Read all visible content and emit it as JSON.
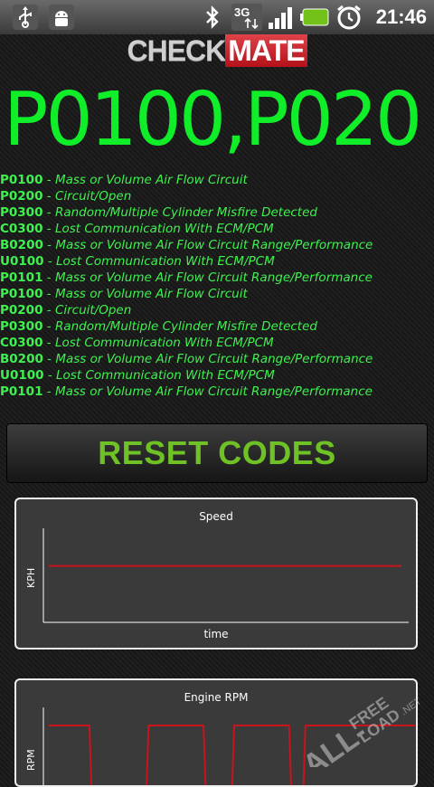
{
  "status_bar": {
    "time": "21:46",
    "network": "3G",
    "icons": [
      "usb-icon",
      "android-debug-icon",
      "bluetooth-icon",
      "network-3g-icon",
      "signal-icon",
      "battery-icon",
      "alarm-icon"
    ]
  },
  "logo": {
    "part1": "CHECK",
    "part2": "MATE"
  },
  "big_codes": "P0100,P020",
  "codes": [
    {
      "code": "P0100",
      "sep": " - ",
      "desc": "Mass or Volume Air Flow Circuit"
    },
    {
      "code": "P0200",
      "sep": " - ",
      "desc": "Circuit/Open"
    },
    {
      "code": "P0300",
      "sep": " - ",
      "desc": "Random/Multiple Cylinder Misfire Detected"
    },
    {
      "code": "C0300",
      "sep": " - ",
      "desc": "Lost Communication With ECM/PCM"
    },
    {
      "code": "B0200",
      "sep": " - ",
      "desc": "Mass or Volume Air Flow Circuit Range/Performance"
    },
    {
      "code": "U0100",
      "sep": " - ",
      "desc": "Lost Communication With ECM/PCM"
    },
    {
      "code": "P0101",
      "sep": " - ",
      "desc": "Mass or Volume Air Flow Circuit Range/Performance"
    },
    {
      "code": "P0100",
      "sep": " - ",
      "desc": "Mass or Volume Air Flow Circuit"
    },
    {
      "code": "P0200",
      "sep": " - ",
      "desc": "Circuit/Open"
    },
    {
      "code": "P0300",
      "sep": " - ",
      "desc": "Random/Multiple Cylinder Misfire Detected"
    },
    {
      "code": "C0300",
      "sep": " - ",
      "desc": "Lost Communication With ECM/PCM"
    },
    {
      "code": "B0200",
      "sep": " - ",
      "desc": "Mass or Volume Air Flow Circuit Range/Performance"
    },
    {
      "code": "U0100",
      "sep": " - ",
      "desc": "Lost Communication With ECM/PCM"
    },
    {
      "code": "P0101",
      "sep": " - ",
      "desc": "Mass or Volume Air Flow Circuit Range/Performance"
    }
  ],
  "reset_button": {
    "label": "RESET CODES"
  },
  "colors": {
    "accent_green": "#10ee2a",
    "button_green": "#6fc226",
    "line_red": "#c8141a",
    "logo_red": "#d8262d"
  },
  "charts": [
    {
      "title": "Speed",
      "xlabel": "time",
      "ylabel": "KPH",
      "line_level": 0.6
    },
    {
      "title": "Engine RPM",
      "ylabel": "RPM",
      "pattern": [
        1,
        1,
        1,
        0,
        0,
        0,
        0,
        1,
        1,
        1,
        1,
        0,
        0,
        1,
        1,
        1,
        1,
        0,
        1,
        1,
        1,
        1,
        1,
        1,
        1,
        1,
        1
      ]
    }
  ],
  "watermark": {
    "text1": "ALL-",
    "text2": "FREE",
    "text3": "LOAD",
    "text4": ".NET"
  }
}
